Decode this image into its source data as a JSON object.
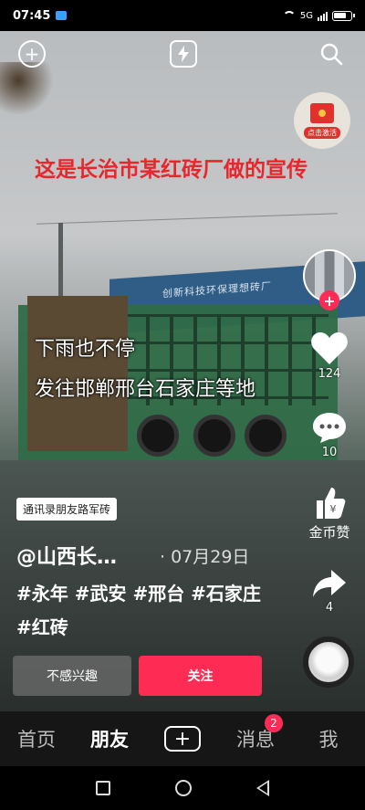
{
  "status_bar": {
    "time": "07:45",
    "network": "5G"
  },
  "video": {
    "caption_red": "这是长治市某红砖厂做的宣传",
    "caption_line1": "下雨也不停",
    "caption_line2": "发往邯郸邢台石家庄等地",
    "sign_text": "创新科技环保理想砖厂"
  },
  "top_bar": {
    "left_icon": "add-circle-icon",
    "center_icon": "flash-icon",
    "right_icon": "search-icon"
  },
  "red_packet": {
    "label": "点击激活"
  },
  "right_actions": {
    "likes": "124",
    "comments": "10",
    "coin_label": "金币赞",
    "shares": "4"
  },
  "info": {
    "chip": "通讯录朋友路军砖",
    "author": "@山西长…",
    "date": "· 07月29日",
    "hashtags": "#永年 #武安 #邢台 #石家庄 #红砖"
  },
  "buttons": {
    "not_interested": "不感兴趣",
    "follow": "关注"
  },
  "tabbar": {
    "home": "首页",
    "friends": "朋友",
    "messages": "消息",
    "messages_badge": "2",
    "me": "我"
  },
  "colors": {
    "accent": "#fe2c55",
    "caption_red": "#e8262c",
    "tabbar_bg": "#161616"
  }
}
